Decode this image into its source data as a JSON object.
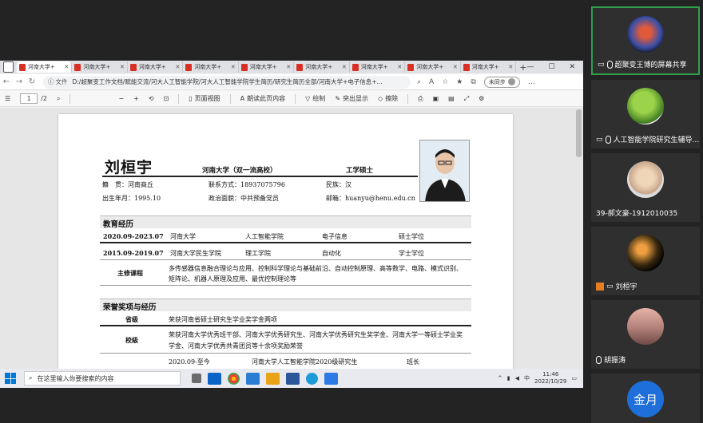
{
  "browser": {
    "tabs": [
      "河南大学+",
      "河南大学+",
      "河南大学+",
      "河南大学+",
      "河南大学+",
      "河南大学+",
      "河南大学+",
      "河南大学+",
      "河南大学+"
    ],
    "file_label": "文件",
    "url": "D:/超聚变工作文档/赋能交流/河大人工智能学院/河大人工智能学院学生简历/研究生简历全部/河南大学+电子信息+...",
    "sync_label": "未同步"
  },
  "pdf_toolbar": {
    "page_current": "1",
    "page_total": "/2",
    "page_view": "页面视图",
    "read_aloud": "朗读此页内容",
    "draw": "绘制",
    "highlight": "突出显示",
    "erase": "擦除"
  },
  "resume": {
    "name": "刘桓宇",
    "school": "河南大学（双一流高校）",
    "degree": "工学硕士",
    "hometown": "籍　贯：河南商丘",
    "contact": "联系方式：18937075796",
    "ethnicity": "民族：汉",
    "birth": "出生年月：1995.10",
    "politics": "政治面貌：中共预备党员",
    "email": "邮箱：huanyu@henu.edu.cn",
    "edu_title": "教育经历",
    "edu": [
      {
        "period": "2020.09-2023.07",
        "school": "河南大学",
        "college": "人工智能学院",
        "major": "电子信息",
        "degree": "硕士学位"
      },
      {
        "period": "2015.09-2019.07",
        "school": "河南大学民生学院",
        "college": "理工学院",
        "major": "自动化",
        "degree": "学士学位"
      }
    ],
    "courses_label": "主修课程",
    "courses": "多传感器信息融合理论与应用、控制科学理论与基础前沿、自动控制原理、高等数学、电路、模式识别、矩阵论、机器人原理及应用、最优控制理论等",
    "honor_title": "荣誉奖项与经历",
    "honors": [
      {
        "level": "省级",
        "text": "荣获河南省硕士研究生学业奖学金两项"
      },
      {
        "level": "校级",
        "text": "荣获河南大学优秀班干部、河南大学优秀研究生、河南大学优秀研究生奖学金、河南大学一等硕士学业奖学金、河南大学优秀共青团员等十余项奖励荣誉"
      }
    ],
    "exp": {
      "period": "2020.09-至今",
      "org": "河南大学人工智能学院2020级研究生",
      "role": "班长"
    }
  },
  "taskbar": {
    "search_placeholder": "在这里输入你要搜索的内容",
    "time": "11:46",
    "date": "2022/10/29",
    "ime": "中"
  },
  "participants": [
    {
      "name": "超聚变王博的屏幕共享"
    },
    {
      "name": "人工智能学院研究生辅导..."
    },
    {
      "name": "39-郝文豪-1912010035"
    },
    {
      "name": "刘桓宇"
    },
    {
      "name": "胡振涛"
    },
    {
      "name": "金月",
      "initials": "金月"
    }
  ]
}
